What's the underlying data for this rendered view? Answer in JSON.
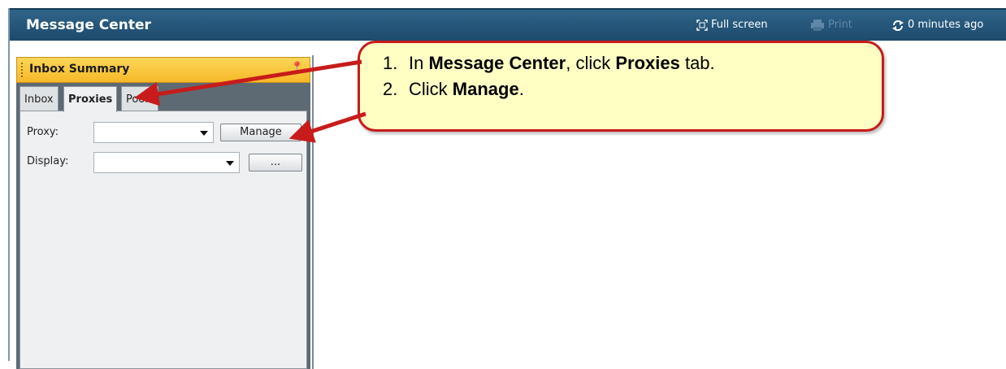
{
  "header": {
    "title": "Message Center",
    "full_screen_label": "Full screen",
    "print_label": "Print",
    "refresh_label": "0 minutes ago"
  },
  "panel": {
    "title": "Inbox Summary",
    "tabs": [
      {
        "label": "Inbox",
        "active": false
      },
      {
        "label": "Proxies",
        "active": true
      },
      {
        "label": "Pools",
        "active": false
      }
    ],
    "proxy_label": "Proxy:",
    "proxy_value": "",
    "manage_button": "Manage",
    "display_label": "Display:",
    "display_value": "",
    "ellipsis_button": "..."
  },
  "callout": {
    "steps": [
      {
        "num": "1.",
        "pre": "In ",
        "b1": "Message Center",
        "mid": ", click ",
        "b2": "Proxies",
        "post": " tab."
      },
      {
        "num": "2.",
        "pre": "Click ",
        "b1": "Manage",
        "mid": ".",
        "b2": "",
        "post": ""
      }
    ]
  },
  "colors": {
    "header_bg": "#25587c",
    "panel_head": "#f8c53d",
    "callout_bg": "#ffffc4",
    "callout_border": "#c81b1b"
  }
}
